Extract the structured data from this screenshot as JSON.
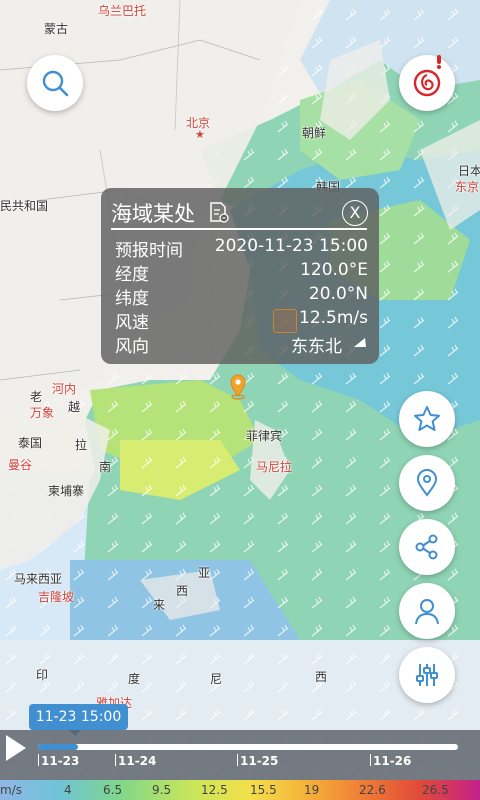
{
  "map_labels": {
    "wulanbatuo": "乌兰巴托",
    "mongolia": "蒙古",
    "beijing": "北京",
    "korea_n": "朝鲜",
    "korea_s": "韩国",
    "japan1": "日本",
    "japan2": "东京",
    "republic": "民共和国",
    "laos": "老",
    "hanoi": "河内",
    "vientiane": "万象",
    "vietnam": "越",
    "thailand": "泰国",
    "bangkok": "曼谷",
    "cambodia": "柬埔寨",
    "la": "拉",
    "nan": "南",
    "philippines": "菲律宾",
    "manila": "马尼拉",
    "malaysia": "马来西亚",
    "kualalumpur": "吉隆坡",
    "xi": "西",
    "ya": "亚",
    "lai": "来",
    "yin": "印",
    "du": "度",
    "ni": "尼",
    "xi2": "西",
    "jakarta": "雅加达"
  },
  "popup": {
    "title": "海域某处",
    "rows": [
      {
        "key": "预报时间",
        "value": "2020-11-23 15:00"
      },
      {
        "key": "经度",
        "value": "120.0°E"
      },
      {
        "key": "纬度",
        "value": "20.0°N"
      },
      {
        "key": "风速",
        "value": "12.5m/s"
      },
      {
        "key": "风向",
        "value": "东东北"
      }
    ],
    "close_label": "X"
  },
  "timeline": {
    "current": "11-23 15:00",
    "progress": 0.095,
    "dates": [
      "11-23",
      "11-24",
      "11-25",
      "11-26"
    ]
  },
  "legend": {
    "unit": "m/s",
    "stops": [
      "4",
      "6.5",
      "9.5",
      "12.5",
      "15.5",
      "19",
      "22.6",
      "26.5"
    ]
  },
  "colors": {
    "accent": "#3f8fd1",
    "alert": "#d8262a"
  }
}
